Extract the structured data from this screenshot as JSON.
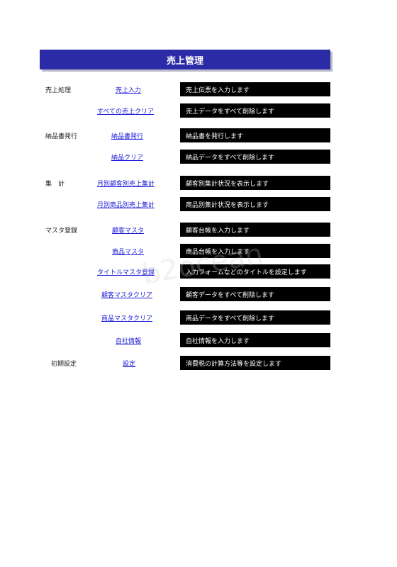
{
  "header": {
    "title": "売上管理"
  },
  "rows": [
    {
      "category": "売上処理",
      "link": "売上入力",
      "desc": "売上伝票を入力します"
    },
    {
      "category": "",
      "link": "すべての売上クリア",
      "desc": "売上データをすべて削除します"
    },
    {
      "category": "納品書発行",
      "link": "納品書発行",
      "desc": "納品書を発行します"
    },
    {
      "category": "",
      "link": "納品クリア",
      "desc": "納品データをすべて削除します"
    },
    {
      "category": "集　計",
      "link": "月別顧客別売上集計",
      "desc": "顧客別集計状況を表示します"
    },
    {
      "category": "",
      "link": "月別商品別売上集計",
      "desc": "商品別集計状況を表示します"
    },
    {
      "category": "マスタ登録",
      "link": "顧客マスタ",
      "desc": "顧客台帳を入力します"
    },
    {
      "category": "",
      "link": "商品マスタ",
      "desc": "商品台帳を入力します"
    },
    {
      "category": "",
      "link": "タイトルマスタ登録",
      "desc": "入力フォームなどのタイトルを設定します"
    },
    {
      "category": "",
      "link": "顧客マスタクリア",
      "desc": "顧客データをすべて削除します"
    },
    {
      "category": "",
      "link": "商品マスタクリア",
      "desc": "商品データをすべて削除します"
    },
    {
      "category": "",
      "link": "自社情報",
      "desc": "自社情報を入力します"
    },
    {
      "category": "初期設定",
      "link": "設定",
      "desc": "消費税の計算方法等を設定します"
    }
  ],
  "watermark": {
    "text": "b2ocean"
  }
}
